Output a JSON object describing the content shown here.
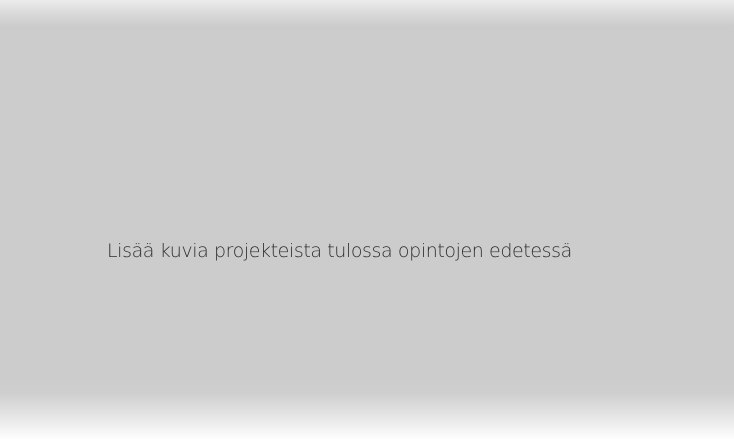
{
  "placeholder": {
    "message": "Lisää kuvia projekteista tulossa opintojen edetessä"
  },
  "colors": {
    "panel_background": "#cccccc",
    "text": "#2f2f2f",
    "page_background": "#ffffff"
  }
}
